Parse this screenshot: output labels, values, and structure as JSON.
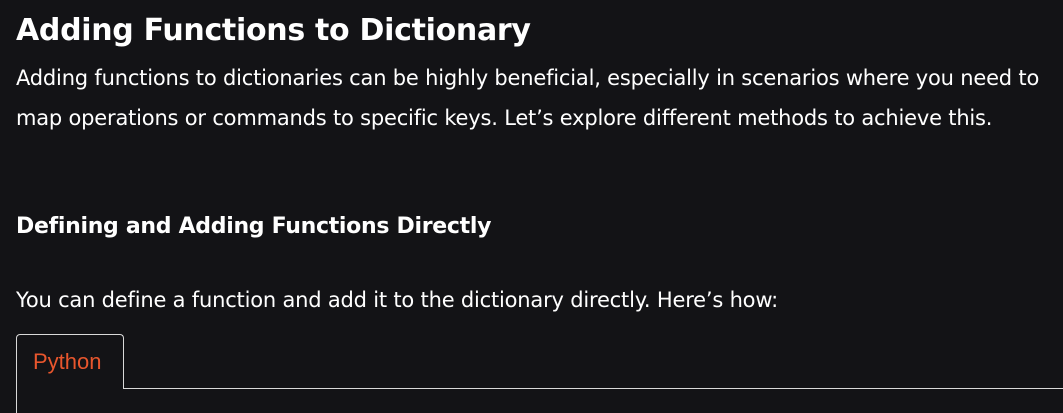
{
  "article": {
    "title": "Adding Functions to Dictionary",
    "intro": "Adding functions to dictionaries can be highly beneficial, especially in scenarios where you need to map operations or commands to specific keys. Let’s explore different methods to achieve this.",
    "section_heading": "Defining and Adding Functions Directly",
    "section_text": "You can define a function and add it to the dictionary directly. Here’s how:"
  },
  "code_block": {
    "tabs": [
      {
        "label": "Python",
        "active": true
      }
    ]
  },
  "colors": {
    "background": "#131316",
    "text": "#ffffff",
    "tab_accent": "#e8562d",
    "border": "#d9d9d9"
  }
}
